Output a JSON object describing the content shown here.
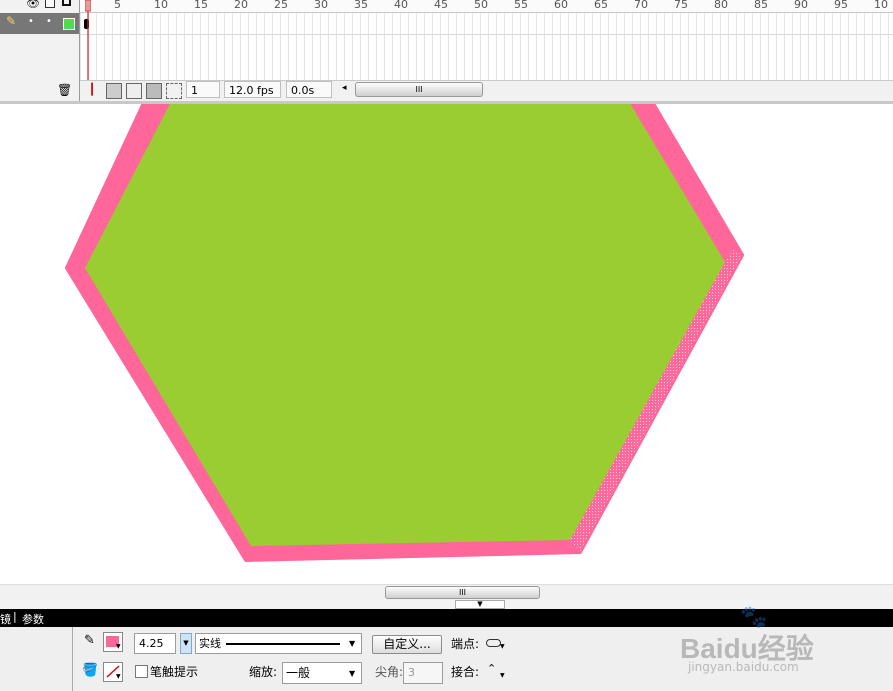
{
  "timeline": {
    "ruler_ticks": [
      "5",
      "10",
      "15",
      "20",
      "25",
      "30",
      "35",
      "40",
      "45",
      "50",
      "55",
      "60",
      "65",
      "70",
      "75",
      "80",
      "85",
      "90",
      "95",
      "10"
    ],
    "current_frame": "1",
    "fps": "12.0 fps",
    "elapsed_time": "0.0s",
    "scroll_grip": "III"
  },
  "stage": {
    "shape": "hexagon",
    "fill_color": "#9ACD32",
    "stroke_color": "#FF6699"
  },
  "stage_scrollbar": {
    "grip": "III"
  },
  "properties": {
    "tabs": [
      "滤镜",
      "参数"
    ],
    "tab_partial": "镜",
    "stroke_height": "4.25",
    "stroke_style": "实线",
    "custom_button": "自定义...",
    "cap_label": "端点:",
    "stroke_hinting_label": "笔触提示",
    "scale_label": "缩放:",
    "scale_value": "一般",
    "miter_label": "尖角:",
    "miter_value": "3",
    "join_label": "接合:",
    "stroke_swatch_color": "#FF6699"
  },
  "watermark": {
    "brand": "Baidu经验",
    "url": "jingyan.baidu.com"
  }
}
